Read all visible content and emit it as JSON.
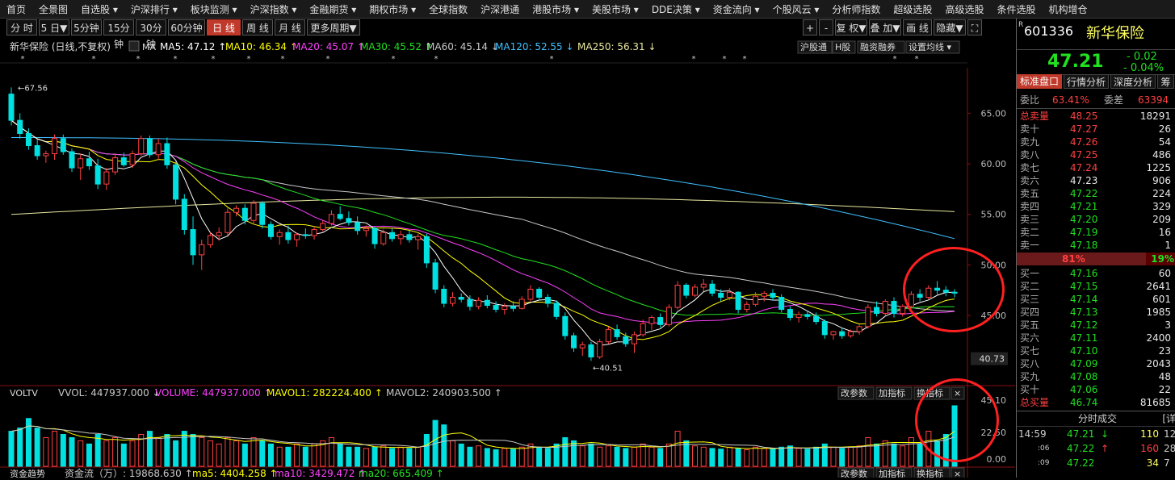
{
  "menu": [
    "首页",
    "全景图",
    "自选股 ▾",
    "沪深排行 ▾",
    "板块监测 ▾",
    "沪深指数 ▾",
    "金融期货 ▾",
    "期权市场 ▾",
    "全球指数",
    "沪深港通",
    "港股市场 ▾",
    "美股市场 ▾",
    "DDE决策 ▾",
    "资金流向 ▾",
    "个股风云 ▾",
    "分析师指数",
    "超级选股",
    "高级选股",
    "条件选股",
    "机构增仓"
  ],
  "periods": [
    "分 时",
    "5 日▼",
    "5分钟",
    "15分钟",
    "30分钟",
    "60分钟",
    "日 线",
    "周 线",
    "月 线",
    "更多周期▼"
  ],
  "right_tools": [
    "+",
    "-",
    "复 权▼",
    "叠 加▼",
    "画 线",
    "隐藏▼",
    "⛶"
  ],
  "stock": {
    "code": "601336",
    "name": "新华保险",
    "price": "47.21",
    "change": "- 0.02",
    "pct": "- 0.04%"
  },
  "tabs": [
    "标准盘口",
    "行情分析",
    "深度分析",
    "筹"
  ],
  "weibi": {
    "label1": "委比",
    "v1": "63.41%",
    "label2": "委差",
    "v2": "63394"
  },
  "sell_total": {
    "label": "总卖量",
    "price": "48.25",
    "vol": "18291"
  },
  "asks": [
    {
      "label": "卖十",
      "price": "47.27",
      "vol": "26"
    },
    {
      "label": "卖九",
      "price": "47.26",
      "vol": "54"
    },
    {
      "label": "卖八",
      "price": "47.25",
      "vol": "486"
    },
    {
      "label": "卖七",
      "price": "47.24",
      "vol": "1225"
    },
    {
      "label": "卖六",
      "price": "47.23",
      "vol": "906"
    },
    {
      "label": "卖五",
      "price": "47.22",
      "vol": "224"
    },
    {
      "label": "卖四",
      "price": "47.21",
      "vol": "329"
    },
    {
      "label": "卖三",
      "price": "47.20",
      "vol": "209"
    },
    {
      "label": "卖二",
      "price": "47.19",
      "vol": "16"
    },
    {
      "label": "卖一",
      "price": "47.18",
      "vol": "1"
    }
  ],
  "ratio": {
    "left": "81%",
    "right": "19%"
  },
  "bids": [
    {
      "label": "买一",
      "price": "47.16",
      "vol": "60"
    },
    {
      "label": "买二",
      "price": "47.15",
      "vol": "2641"
    },
    {
      "label": "买三",
      "price": "47.14",
      "vol": "601"
    },
    {
      "label": "买四",
      "price": "47.13",
      "vol": "1985"
    },
    {
      "label": "买五",
      "price": "47.12",
      "vol": "3"
    },
    {
      "label": "买六",
      "price": "47.11",
      "vol": "2400"
    },
    {
      "label": "买七",
      "price": "47.10",
      "vol": "23"
    },
    {
      "label": "买八",
      "price": "47.09",
      "vol": "2043"
    },
    {
      "label": "买九",
      "price": "47.08",
      "vol": "48"
    },
    {
      "label": "买十",
      "price": "47.06",
      "vol": "22"
    }
  ],
  "buy_total": {
    "label": "总买量",
    "price": "46.74",
    "vol": "81685"
  },
  "trades_header": {
    "title": "分时成交",
    "more": "[详"
  },
  "trades": [
    {
      "time": "14:59",
      "price": "47.21↓",
      "vol": "110",
      "n": "12"
    },
    {
      "time": ":06",
      "price": "47.22↑",
      "vol": "160",
      "n": "28"
    },
    {
      "time": ":09",
      "price": "47.22",
      "vol": "34",
      "n": "7"
    }
  ],
  "kline": {
    "title": "新华保险 (日线,不复权)",
    "ma_label": "MA",
    "ma": [
      {
        "label": "MA5: 47.12 ↑",
        "color": "#ffffff"
      },
      {
        "label": "MA10: 46.34 ↑",
        "color": "#ffff00"
      },
      {
        "label": "MA20: 45.07 ↑",
        "color": "#ff40ff"
      },
      {
        "label": "MA30: 45.52 ↑",
        "color": "#20e020"
      },
      {
        "label": "MA60: 45.14 ↓",
        "color": "#c8c8c8"
      },
      {
        "label": "MA120: 52.55 ↓",
        "color": "#40c0ff"
      },
      {
        "label": "MA250: 56.31 ↓",
        "color": "#e8e8a0"
      }
    ],
    "buttons": [
      "沪股通",
      "H股",
      "融资融券",
      "设置均线 ▾"
    ],
    "yticks": [
      "65.00",
      "60.00",
      "55.00",
      "50.00",
      "45.00"
    ],
    "yvalues": [
      65,
      60,
      55,
      50,
      45
    ],
    "last_label": "40.73",
    "high_label": "67.56",
    "low_label": "40.51",
    "ylim": [
      39.5,
      69.5
    ]
  },
  "volume": {
    "title": "VOLTV",
    "items": [
      {
        "label": "VVOL: 447937.000 ↓",
        "color": "#c8c8c8"
      },
      {
        "label": "VOLUME: 447937.000 ↑",
        "color": "#ff40ff"
      },
      {
        "label": "MAVOL1: 282224.400 ↑",
        "color": "#ffff00"
      },
      {
        "label": "MAVOL2: 240903.500 ↑",
        "color": "#c8c8c8"
      }
    ],
    "buttons": [
      "改参数",
      "加指标",
      "换指标",
      "×"
    ],
    "yticks": [
      "45.10",
      "22.50",
      "0.00"
    ]
  },
  "money": {
    "title": "资金趋势",
    "items": [
      {
        "label": "资金流（万）: 19868.630 ↑",
        "color": "#c8c8c8"
      },
      {
        "label": "ma5: 4404.258 ↑",
        "color": "#ffff00"
      },
      {
        "label": "ma10: 3429.472 ↑",
        "color": "#ff40ff"
      },
      {
        "label": "ma20: 665.409 ↑",
        "color": "#20e020"
      }
    ],
    "buttons": [
      "改参数",
      "加指标",
      "换指标",
      "×"
    ]
  },
  "chart_data": {
    "type": "candlestick",
    "note_candles": [
      [
        66.9,
        67.56,
        63.8,
        64.3
      ],
      [
        64.3,
        65.0,
        62.5,
        63.0
      ],
      [
        63.0,
        63.5,
        61.4,
        61.8
      ],
      [
        61.8,
        62.4,
        60.4,
        60.8
      ],
      [
        60.8,
        61.3,
        60.1,
        61.0
      ],
      [
        61.0,
        62.9,
        60.4,
        62.5
      ],
      [
        62.5,
        62.9,
        60.9,
        61.2
      ],
      [
        61.2,
        61.5,
        59.2,
        59.6
      ],
      [
        59.6,
        61.0,
        58.4,
        60.5
      ],
      [
        60.5,
        61.2,
        59.4,
        59.8
      ],
      [
        59.8,
        60.5,
        57.5,
        58.0
      ],
      [
        58.0,
        59.6,
        57.4,
        59.2
      ],
      [
        59.2,
        61.0,
        58.9,
        60.6
      ],
      [
        60.6,
        61.1,
        59.7,
        59.9
      ],
      [
        59.9,
        61.3,
        59.6,
        61.0
      ],
      [
        61.0,
        62.8,
        60.8,
        62.5
      ],
      [
        62.5,
        62.8,
        60.6,
        60.9
      ],
      [
        60.9,
        62.5,
        60.4,
        62.0
      ],
      [
        62.0,
        62.6,
        59.5,
        59.9
      ],
      [
        59.9,
        60.2,
        56.0,
        56.5
      ],
      [
        56.5,
        57.0,
        53.0,
        53.5
      ],
      [
        53.5,
        54.8,
        50.0,
        51.0
      ],
      [
        51.0,
        52.5,
        49.5,
        52.0
      ],
      [
        52.0,
        53.2,
        51.7,
        52.9
      ],
      [
        52.9,
        53.7,
        52.4,
        53.2
      ],
      [
        53.2,
        55.6,
        52.9,
        55.2
      ],
      [
        55.2,
        55.9,
        54.8,
        55.6
      ],
      [
        55.6,
        56.0,
        54.0,
        54.4
      ],
      [
        54.4,
        56.4,
        54.0,
        56.1
      ],
      [
        56.1,
        56.3,
        53.6,
        54.0
      ],
      [
        54.0,
        54.3,
        52.5,
        52.8
      ],
      [
        52.8,
        53.5,
        52.0,
        53.2
      ],
      [
        53.2,
        53.9,
        52.1,
        52.5
      ],
      [
        52.5,
        53.2,
        51.8,
        53.0
      ],
      [
        53.0,
        53.6,
        52.6,
        52.9
      ],
      [
        52.9,
        53.8,
        52.5,
        53.5
      ],
      [
        53.5,
        54.4,
        53.3,
        54.1
      ],
      [
        54.1,
        55.4,
        53.9,
        55.0
      ],
      [
        55.0,
        55.8,
        54.4,
        54.6
      ],
      [
        54.6,
        55.3,
        53.9,
        54.2
      ],
      [
        54.2,
        54.8,
        53.0,
        53.4
      ],
      [
        53.4,
        53.9,
        52.8,
        53.6
      ],
      [
        53.6,
        53.8,
        51.6,
        52.1
      ],
      [
        52.1,
        53.5,
        51.9,
        53.2
      ],
      [
        53.2,
        53.6,
        52.3,
        52.6
      ],
      [
        52.6,
        53.4,
        52.0,
        53.0
      ],
      [
        53.0,
        53.4,
        52.2,
        52.5
      ],
      [
        52.5,
        53.1,
        51.5,
        52.8
      ],
      [
        52.8,
        53.1,
        49.7,
        50.2
      ],
      [
        50.2,
        50.6,
        47.2,
        47.6
      ],
      [
        47.6,
        48.0,
        45.8,
        46.2
      ],
      [
        46.2,
        47.3,
        45.9,
        46.8
      ],
      [
        46.8,
        47.2,
        46.3,
        46.6
      ],
      [
        46.6,
        47.0,
        45.5,
        45.9
      ],
      [
        45.9,
        46.8,
        45.6,
        46.5
      ],
      [
        46.5,
        47.0,
        45.7,
        46.0
      ],
      [
        46.0,
        46.4,
        45.3,
        45.6
      ],
      [
        45.6,
        46.2,
        45.1,
        45.9
      ],
      [
        45.9,
        46.4,
        45.4,
        45.7
      ],
      [
        45.7,
        46.9,
        45.6,
        46.6
      ],
      [
        46.6,
        48.0,
        46.4,
        47.6
      ],
      [
        47.6,
        47.8,
        46.5,
        46.8
      ],
      [
        46.8,
        47.1,
        45.8,
        46.2
      ],
      [
        46.2,
        46.5,
        44.6,
        44.9
      ],
      [
        44.9,
        45.3,
        42.6,
        43.0
      ],
      [
        43.0,
        43.3,
        41.4,
        41.8
      ],
      [
        41.8,
        42.4,
        41.0,
        42.1
      ],
      [
        42.1,
        42.4,
        40.51,
        40.9
      ],
      [
        40.9,
        42.7,
        40.7,
        42.4
      ],
      [
        42.4,
        43.9,
        42.2,
        43.6
      ],
      [
        43.6,
        44.1,
        42.6,
        42.9
      ],
      [
        42.9,
        43.3,
        41.9,
        42.2
      ],
      [
        42.2,
        43.4,
        41.3,
        43.1
      ],
      [
        43.1,
        44.6,
        42.9,
        44.2
      ],
      [
        44.2,
        45.0,
        43.6,
        44.8
      ],
      [
        44.8,
        45.2,
        43.8,
        44.1
      ],
      [
        44.1,
        46.1,
        43.9,
        45.8
      ],
      [
        45.8,
        48.4,
        45.6,
        48.0
      ],
      [
        48.0,
        48.2,
        46.7,
        47.0
      ],
      [
        47.0,
        48.1,
        46.8,
        47.8
      ],
      [
        47.8,
        48.6,
        47.4,
        48.1
      ],
      [
        48.1,
        48.5,
        46.9,
        47.2
      ],
      [
        47.2,
        47.6,
        46.4,
        46.8
      ],
      [
        46.8,
        47.7,
        46.5,
        47.3
      ],
      [
        47.3,
        47.4,
        45.2,
        45.6
      ],
      [
        45.6,
        46.4,
        45.3,
        46.1
      ],
      [
        46.1,
        47.3,
        45.9,
        46.9
      ],
      [
        46.9,
        47.4,
        46.4,
        47.2
      ],
      [
        47.2,
        47.6,
        46.5,
        46.8
      ],
      [
        46.8,
        47.1,
        45.3,
        45.6
      ],
      [
        45.6,
        45.9,
        44.5,
        44.8
      ],
      [
        44.8,
        45.4,
        44.3,
        45.1
      ],
      [
        45.1,
        45.5,
        44.6,
        44.9
      ],
      [
        44.9,
        45.3,
        44.1,
        44.4
      ],
      [
        44.4,
        44.6,
        42.7,
        43.1
      ],
      [
        43.1,
        43.5,
        42.6,
        43.4
      ],
      [
        43.4,
        43.8,
        42.7,
        43.0
      ],
      [
        43.0,
        43.6,
        42.8,
        43.4
      ],
      [
        43.4,
        44.1,
        43.1,
        43.9
      ],
      [
        43.9,
        46.1,
        43.7,
        45.8
      ],
      [
        45.8,
        46.4,
        44.9,
        45.2
      ],
      [
        45.2,
        46.6,
        45.0,
        46.4
      ],
      [
        46.4,
        46.8,
        44.8,
        45.2
      ],
      [
        45.2,
        46.1,
        44.9,
        45.9
      ],
      [
        45.9,
        47.4,
        45.7,
        47.1
      ],
      [
        47.1,
        47.6,
        46.4,
        46.8
      ],
      [
        46.8,
        48.0,
        46.6,
        47.7
      ],
      [
        47.7,
        48.4,
        47.1,
        47.5
      ],
      [
        47.5,
        47.9,
        46.9,
        47.3
      ],
      [
        47.3,
        47.6,
        46.8,
        47.21
      ]
    ]
  }
}
